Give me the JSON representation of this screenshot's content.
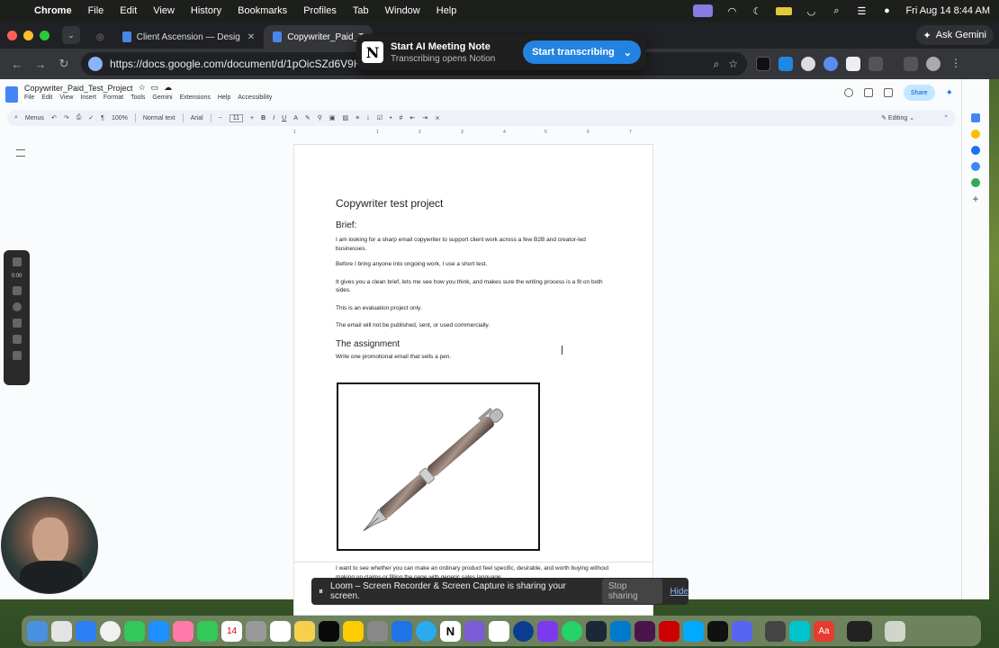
{
  "menubar": {
    "app": "Chrome",
    "items": [
      "File",
      "Edit",
      "View",
      "History",
      "Bookmarks",
      "Profiles",
      "Tab",
      "Window",
      "Help"
    ],
    "datetime": "Fri Aug 14  8:44 AM"
  },
  "tabs": {
    "tab1": "Client Ascension — Desig",
    "tab2": "Copywriter_Paid_T",
    "ask_gemini": "Ask Gemini"
  },
  "omnibox": {
    "url": "https://docs.google.com/document/d/1pOicSZd6V9KfYGt"
  },
  "notion_popup": {
    "title": "Start AI Meeting Note",
    "subtitle": "Transcribing opens Notion",
    "button": "Start transcribing",
    "logo": "N"
  },
  "docs": {
    "title": "Copywriter_Paid_Test_Project",
    "menus": [
      "File",
      "Edit",
      "View",
      "Insert",
      "Format",
      "Tools",
      "Gemini",
      "Extensions",
      "Help",
      "Accessibility"
    ],
    "share": "Share",
    "toolbar": {
      "menus": "Menus",
      "zoom": "100%",
      "style": "Normal text",
      "font": "Arial",
      "size": "11",
      "editing": "Editing"
    },
    "ruler": [
      "1",
      "1",
      "2",
      "3",
      "4",
      "5",
      "6",
      "7"
    ]
  },
  "document": {
    "heading": "Copywriter test project",
    "brief_heading": "Brief:",
    "p1": "I am looking for a sharp email copywriter to support client work across a few B2B and creator-led businesses.",
    "p2": "Before I bring anyone into ongoing work, I use a short test.",
    "p3": "It gives you a clean brief, lets me see how you think, and makes sure the writing process is a fit on both sides.",
    "p4": "This is an evaluation project only.",
    "p5": "The email will not be published, sent, or used commercially.",
    "assignment_heading": "The assignment",
    "p6": "Write one promotional email that sells a pen.",
    "p7": "I want to see whether you can make an ordinary product feel specific, desirable, and worth buying without making up claims or filling the page with generic sales language."
  },
  "loom": {
    "timer": "0:00",
    "bar_text": "Loom – Screen Recorder & Screen Capture is sharing your screen.",
    "stop": "Stop sharing",
    "hide": "Hide"
  },
  "colors": {
    "accent": "#2383e2",
    "docs_blue": "#4285f4"
  }
}
